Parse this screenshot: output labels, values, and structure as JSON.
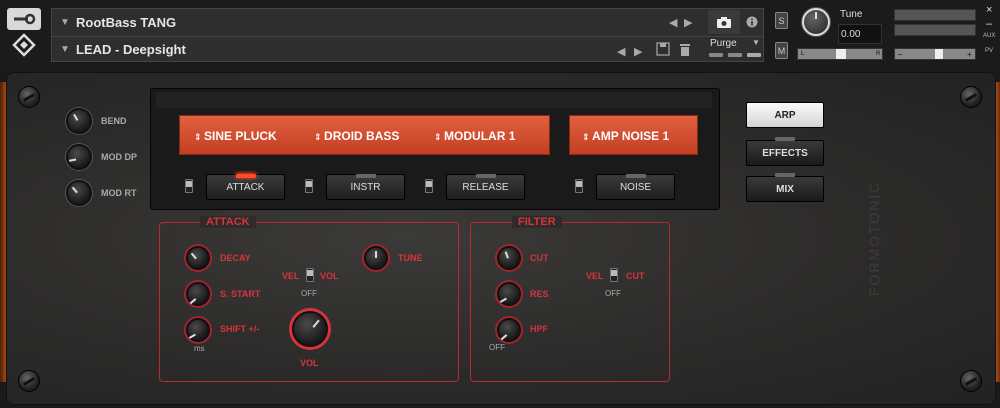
{
  "header": {
    "instrument_name": "RootBass TANG",
    "preset_name": "LEAD - Deepsight",
    "purge_label": "Purge",
    "solo_label": "S",
    "mute_label": "M",
    "tune_label": "Tune",
    "tune_value": "0.00",
    "pan_left": "L",
    "pan_right": "R",
    "volume_minus": "–",
    "volume_plus": "+",
    "close_label": "×",
    "minimize_label": "–",
    "aux_label": "AUX",
    "pv_label": "PV"
  },
  "side_knobs": [
    "BEND",
    "MOD DP",
    "MOD RT"
  ],
  "sources": {
    "slot1": "SINE PLUCK",
    "slot2": "DROID BASS",
    "slot3": "MODULAR 1",
    "slot4": "AMP NOISE 1"
  },
  "tabs": [
    "ATTACK",
    "INSTR",
    "RELEASE",
    "NOISE"
  ],
  "active_tab": "ATTACK",
  "right_buttons": [
    "ARP",
    "EFFECTS",
    "MIX"
  ],
  "attack": {
    "title": "ATTACK",
    "decay": "DECAY",
    "sstart": "S. START",
    "shift": "SHIFT +/-",
    "ms": "ms",
    "vel": "VEL",
    "vol": "VOL",
    "off": "OFF",
    "tune": "TUNE",
    "vol_knob": "VOL"
  },
  "filter": {
    "title": "FILTER",
    "cut": "CUT",
    "res": "RES",
    "hpf": "HPF",
    "off": "OFF",
    "vel": "VEL",
    "cut2": "CUT",
    "off2": "OFF"
  },
  "brand_text": "FORMOTONIC",
  "colors": {
    "accent": "#d8333b",
    "orange": "#d4502f",
    "led_on": "#ff4a2a"
  }
}
